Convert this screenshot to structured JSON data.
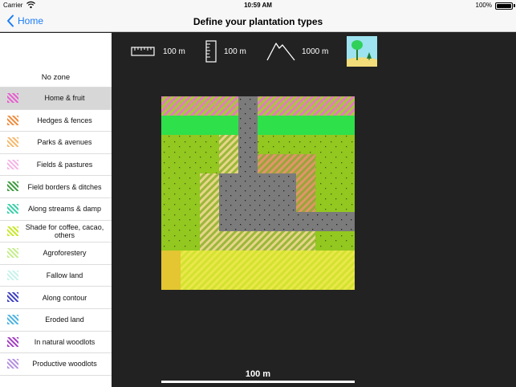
{
  "status": {
    "carrier": "Carrier",
    "time": "10:59 AM",
    "battery": "100%"
  },
  "nav": {
    "back": "Home",
    "title": "Define your plantation types"
  },
  "sidebar": {
    "no_zone": "No zone",
    "items": [
      {
        "label": "Home & fruit",
        "color": "#e85ad0",
        "selected": true
      },
      {
        "label": "Hedges & fences",
        "color": "#f08a3a"
      },
      {
        "label": "Parks & avenues",
        "color": "#f7b86a"
      },
      {
        "label": "Fields & pastures",
        "color": "#f5b3e6"
      },
      {
        "label": "Field borders & ditches",
        "color": "#3d9a3d"
      },
      {
        "label": "Along streams & damp",
        "color": "#35cfa8"
      },
      {
        "label": "Shade for coffee, cacao, others",
        "color": "#c6e827"
      },
      {
        "label": "Agroforestery",
        "color": "#c3ee8a"
      },
      {
        "label": "Fallow land",
        "color": "#c6f2ea"
      },
      {
        "label": "Along contour",
        "color": "#3c3fc2"
      },
      {
        "label": "Eroded land",
        "color": "#4ab2e2"
      },
      {
        "label": "In natural woodlots",
        "color": "#a23bc4"
      },
      {
        "label": "Productive woodlots",
        "color": "#b48ee0"
      }
    ]
  },
  "toolbar": {
    "width": "100 m",
    "height": "100 m",
    "altitude": "1000 m"
  },
  "scale": {
    "label": "100 m"
  }
}
